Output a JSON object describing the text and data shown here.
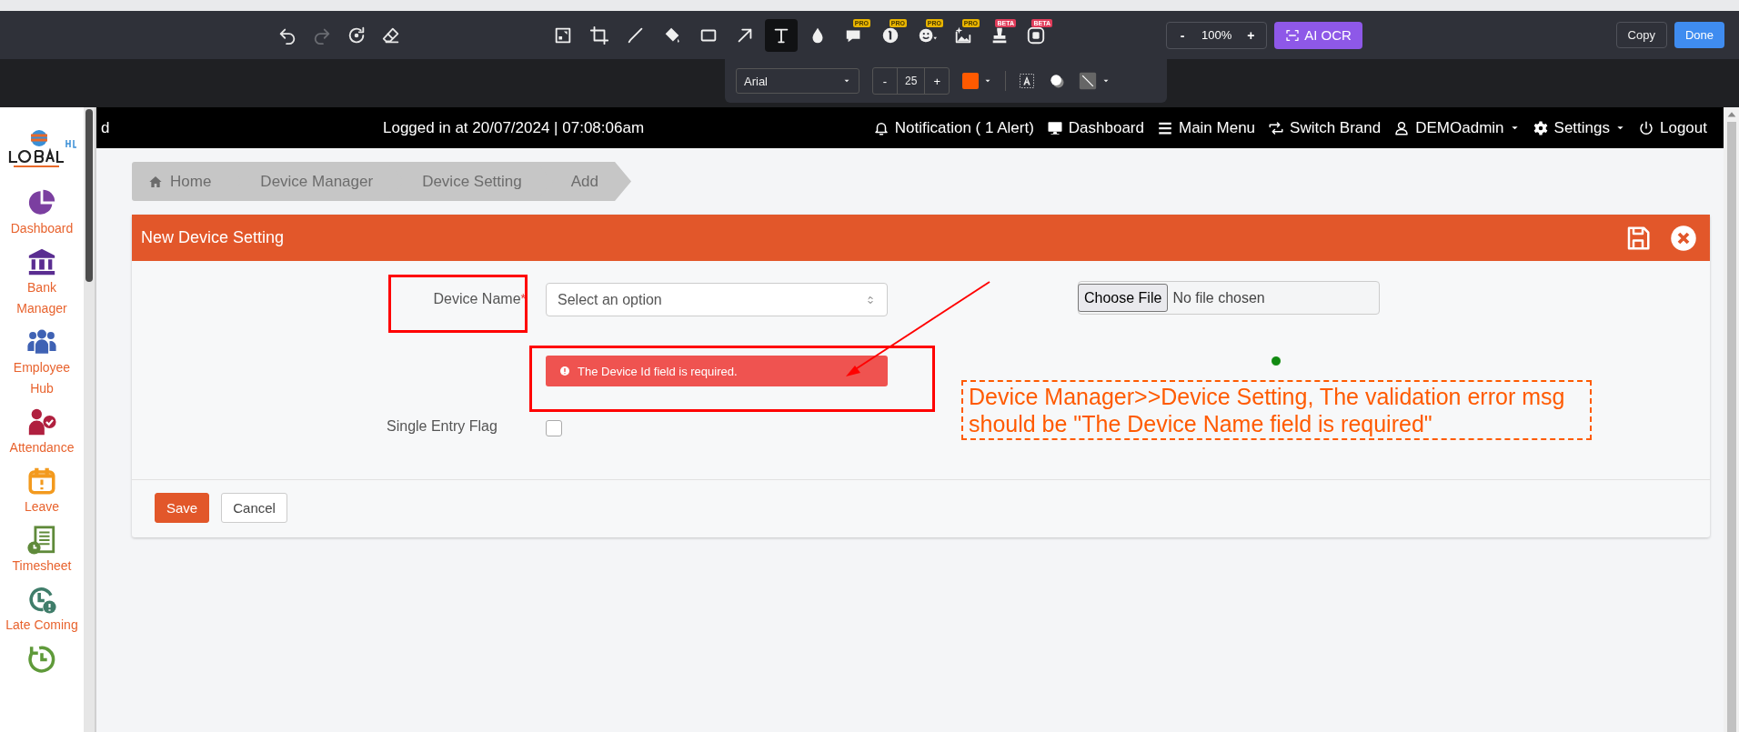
{
  "editor": {
    "history_tools": [
      {
        "kind": "undo",
        "disabled": false
      },
      {
        "kind": "redo",
        "disabled": true
      },
      {
        "kind": "reset",
        "disabled": false
      },
      {
        "kind": "eraser",
        "disabled": false
      }
    ],
    "tools": [
      {
        "kind": "resize",
        "selected": false
      },
      {
        "kind": "crop",
        "selected": false
      },
      {
        "kind": "pen",
        "selected": false
      },
      {
        "kind": "fill",
        "selected": false
      },
      {
        "kind": "rect",
        "selected": false
      },
      {
        "kind": "arrow",
        "selected": false
      },
      {
        "kind": "text",
        "selected": true
      },
      {
        "kind": "drop",
        "selected": false
      },
      {
        "kind": "callout",
        "selected": false,
        "badge": "PRO"
      },
      {
        "kind": "number",
        "selected": false,
        "badge": "PRO"
      },
      {
        "kind": "emoji",
        "selected": false,
        "badge": "PRO"
      },
      {
        "kind": "sticker",
        "selected": false,
        "badge": "PRO"
      },
      {
        "kind": "stamp",
        "selected": false,
        "badge": "BETA"
      },
      {
        "kind": "record",
        "selected": false,
        "badge": "BETA"
      }
    ],
    "zoom": {
      "minus": "-",
      "value": "100%",
      "plus": "+"
    },
    "ai_ocr": "AI OCR",
    "copy": "Copy",
    "done": "Done",
    "text_options": {
      "font": "Arial",
      "size_minus": "-",
      "size": "25",
      "size_plus": "+",
      "color": "#ff5a00"
    }
  },
  "page": {
    "header": {
      "cut_text": "d",
      "login": "Logged in at 20/07/2024 | 07:08:06am",
      "nav": [
        {
          "label": "Notification ( 1 Alert)",
          "caret": false
        },
        {
          "label": "Dashboard",
          "caret": false
        },
        {
          "label": "Main Menu",
          "caret": false
        },
        {
          "label": "Switch Brand",
          "caret": false
        },
        {
          "label": "DEMOadmin",
          "caret": true
        },
        {
          "label": "Settings",
          "caret": true
        },
        {
          "label": "Logout",
          "caret": false
        }
      ]
    },
    "sidebar": [
      {
        "label": "Dashboard",
        "color": "#7b3fa0"
      },
      {
        "label": "Bank Manager",
        "color": "#5a2d91"
      },
      {
        "label": "Employee Hub",
        "color": "#3f62b4"
      },
      {
        "label": "Attendance",
        "color": "#b0203f"
      },
      {
        "label": "Leave",
        "color": "#f39a1e"
      },
      {
        "label": "Timesheet",
        "color": "#5f8a3a"
      },
      {
        "label": "Late Coming",
        "color": "#3f7d6a"
      },
      {
        "color": "#5f9a3a"
      }
    ],
    "breadcrumbs": [
      {
        "label": "Home",
        "home": true
      },
      {
        "label": "Device Manager",
        "home": false
      },
      {
        "label": "Device Setting",
        "home": false
      },
      {
        "label": "Add",
        "home": false
      }
    ],
    "card": {
      "title": "New Device Setting",
      "device_name": {
        "label": "Device Name",
        "required_mark": "*",
        "placeholder": "Select an option",
        "error": "The Device Id field is required."
      },
      "file": {
        "button": "Choose File",
        "status": "No file chosen"
      },
      "single_entry_flag": {
        "label": "Single Entry Flag",
        "checked": false
      },
      "buttons": [
        {
          "kind": "primary",
          "label": "Save"
        },
        {
          "kind": "default",
          "label": "Cancel"
        }
      ]
    }
  },
  "annotation": {
    "note": " Device Manager>>Device Setting, The validation error msg should be \"The Device Name field is required\""
  }
}
